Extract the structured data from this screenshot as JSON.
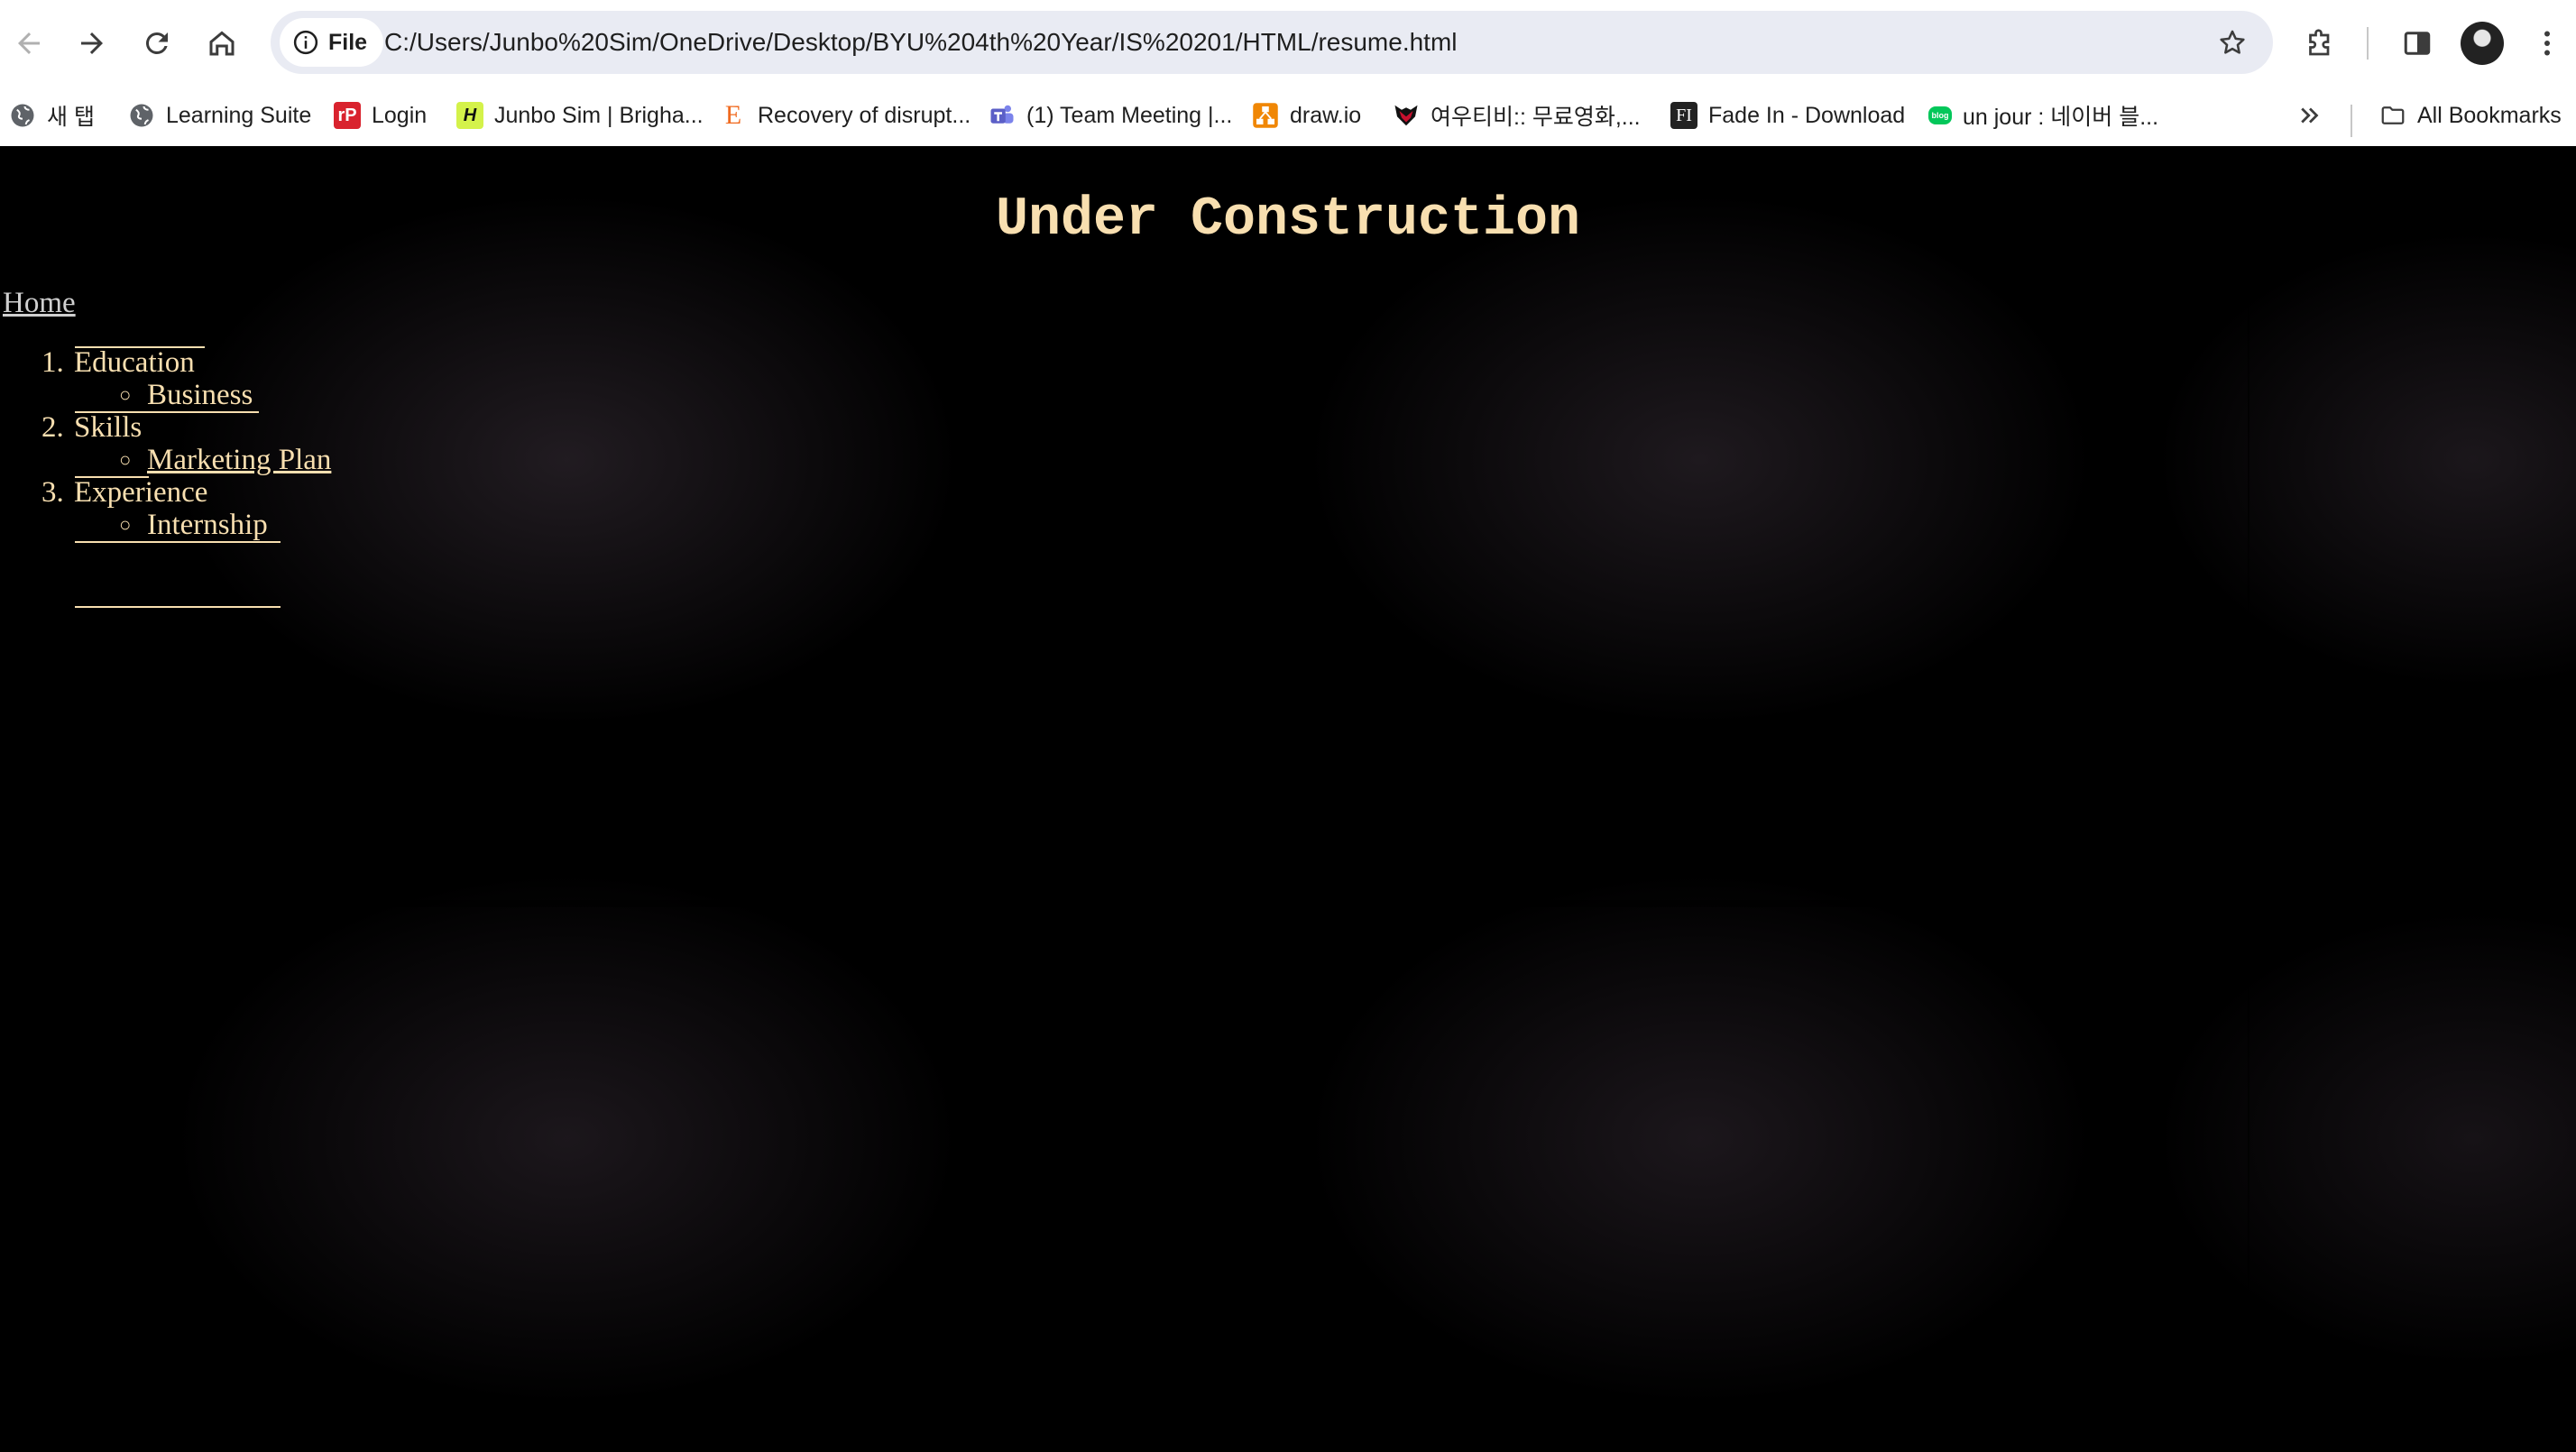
{
  "browser": {
    "url_chip_label": "File",
    "url": "C:/Users/Junbo%20Sim/OneDrive/Desktop/BYU%204th%20Year/IS%20201/HTML/resume.html"
  },
  "bookmarks": [
    {
      "label": "새 탭",
      "icon": "globe-icon"
    },
    {
      "label": "Learning Suite",
      "icon": "globe-icon"
    },
    {
      "label": "Login",
      "icon": "rp-icon",
      "icon_text": "rP",
      "color": "#d9232e"
    },
    {
      "label": "Junbo Sim | Brigha...",
      "icon": "handshake-icon",
      "icon_text": "H",
      "color": "#d4f24a"
    },
    {
      "label": "Recovery of disrupt...",
      "icon": "e-logo-icon",
      "icon_text": "E",
      "color": "#f06a1f"
    },
    {
      "label": "(1) Team Meeting |...",
      "icon": "teams-icon",
      "color": "#5b5fc7"
    },
    {
      "label": "draw.io",
      "icon": "drawio-icon",
      "color": "#f08705"
    },
    {
      "label": "여우티비:: 무료영화,...",
      "icon": "fox-icon",
      "color": "#c8102e"
    },
    {
      "label": "Fade In - Download",
      "icon": "fadein-icon",
      "icon_text": "FI",
      "color": "#222222"
    },
    {
      "label": "un jour : 네이버 블...",
      "icon": "naver-blog-icon",
      "icon_text": "blog",
      "color": "#03c75a"
    }
  ],
  "all_bookmarks_label": "All Bookmarks",
  "page": {
    "title": "Under Construction",
    "home_link": "Home",
    "items": [
      {
        "number": "1.",
        "label": "Education",
        "sub": "Business"
      },
      {
        "number": "2.",
        "label": "Skills",
        "sub": "Marketing Plan"
      },
      {
        "number": "3.",
        "label": "Experience",
        "sub": "Internship"
      }
    ]
  },
  "colors": {
    "heading": "#f8dfb0",
    "link": "#cfcfcf",
    "background": "#000000"
  }
}
